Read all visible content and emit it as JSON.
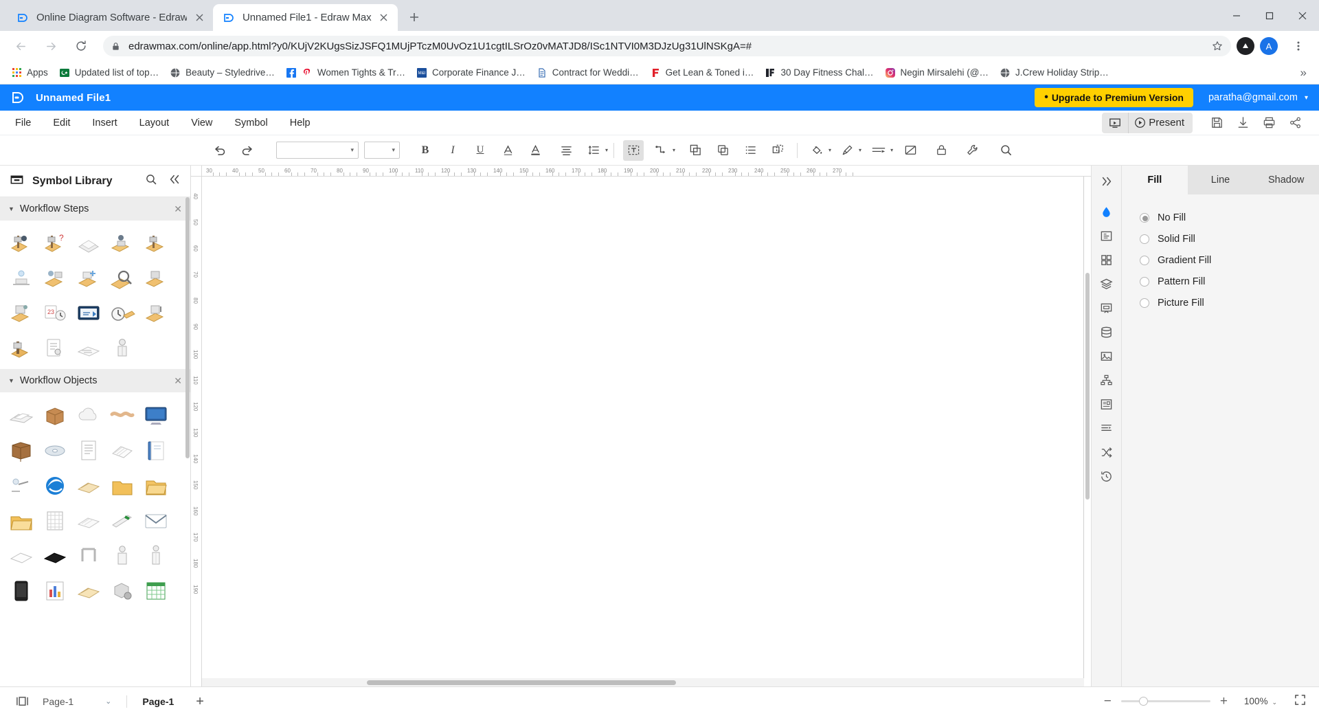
{
  "browser": {
    "tabs": [
      {
        "title": "Online Diagram Software - Edraw",
        "favicon": "edraw-icon",
        "active": false
      },
      {
        "title": "Unnamed File1 - Edraw Max",
        "favicon": "edraw-icon",
        "active": true
      }
    ],
    "new_tab_label": "+",
    "window_controls": {
      "minimize": "–",
      "maximize": "▢",
      "close": "✕"
    },
    "nav": {
      "back": "back-arrow-icon",
      "forward": "forward-arrow-icon",
      "reload": "reload-icon"
    },
    "omnibox": {
      "lock": "lock-icon",
      "url": "edrawmax.com/online/app.html?y0/KUjV2KUgsSizJSFQ1MUjPTczM0UvOz1U1cgtILSrOz0vMATJD8/ISc1NTVI0M3DJzUg31UlNSKgA=#",
      "star": "star-icon"
    },
    "profile": {
      "initial": "A"
    },
    "bookmarks": [
      {
        "label": "Apps",
        "icon": "apps-grid-icon"
      },
      {
        "label": "Updated list of top…",
        "icon": "green-flag-icon"
      },
      {
        "label": "Beauty – Styledrive…",
        "icon": "globe-dark-icon"
      },
      {
        "label": "Women Tights & Tr…",
        "icon": "facebook-icon"
      },
      {
        "label": "Corporate Finance J…",
        "icon": "mbl-blue-icon"
      },
      {
        "label": "Contract for Weddi…",
        "icon": "doc-blue-icon"
      },
      {
        "label": "Get Lean & Toned i…",
        "icon": "red-f-icon"
      },
      {
        "label": "30 Day Fitness Chal…",
        "icon": "dark-jf-icon"
      },
      {
        "label": "Negin Mirsalehi (@…",
        "icon": "instagram-icon"
      },
      {
        "label": "J.Crew Holiday Strip…",
        "icon": "globe-dark-icon"
      }
    ],
    "bookmarks_overflow": "»"
  },
  "app": {
    "title": "Unnamed File1",
    "logo": "edraw-logo-icon",
    "upgrade_label": "Upgrade to Premium Version",
    "upgrade_dot": "•",
    "account": "paratha@gmail.com",
    "account_caret": "▾",
    "menus": [
      "File",
      "Edit",
      "Insert",
      "Layout",
      "View",
      "Symbol",
      "Help"
    ],
    "present": {
      "slideshow_icon": "slideshow-icon",
      "label": "Present",
      "play_icon": "play-circle-icon"
    },
    "quick_actions": [
      {
        "name": "save-icon"
      },
      {
        "name": "download-icon"
      },
      {
        "name": "print-icon"
      },
      {
        "name": "share-icon"
      }
    ]
  },
  "formatbar": {
    "undo": "undo-icon",
    "redo": "redo-icon",
    "font_family": "",
    "font_size": "",
    "bold": "B",
    "italic": "I",
    "underline": "U",
    "font_color": "A",
    "highlight": "text-highlight-icon",
    "align": "align-icon",
    "line_spacing": "line-spacing-icon",
    "text_box": "text-box-icon",
    "connector": "connector-icon",
    "group": "group-icon",
    "duplicate": "duplicate-icon",
    "list": "list-icon",
    "arrange": "arrange-icon",
    "fill": "fill-bucket-icon",
    "line_style": "brush-icon",
    "line_type": "line-type-icon",
    "no_shape": "no-shape-icon",
    "lock": "lock-icon",
    "tools": "wrench-icon",
    "search": "search-icon"
  },
  "library": {
    "header_title": "Symbol Library",
    "header_icon": "library-box-icon",
    "search_icon": "search-icon",
    "collapse_icon": "double-chevron-left-icon",
    "sections": [
      {
        "title": "Workflow Steps",
        "close_label": "✕",
        "symbol_count": 19
      },
      {
        "title": "Workflow Objects",
        "close_label": "✕",
        "symbol_count": 30
      }
    ]
  },
  "ruler": {
    "horizontal_ticks": [
      "30",
      "40",
      "50",
      "60",
      "70",
      "80",
      "90",
      "100",
      "110",
      "120",
      "130",
      "140",
      "150",
      "160",
      "170",
      "180",
      "190",
      "200",
      "210",
      "220",
      "230",
      "240",
      "250",
      "260",
      "270"
    ],
    "vertical_ticks": [
      "40",
      "50",
      "60",
      "70",
      "80",
      "90",
      "100",
      "110",
      "120",
      "130",
      "140",
      "150",
      "160",
      "170",
      "180",
      "190"
    ]
  },
  "rail": {
    "expand_icon": "double-chevron-right-icon",
    "items": [
      {
        "name": "fill-droplet-icon",
        "active": true
      },
      {
        "name": "frame-icon",
        "active": false
      },
      {
        "name": "grid-icon",
        "active": false
      },
      {
        "name": "layers-icon",
        "active": false
      },
      {
        "name": "presentation-icon",
        "active": false
      },
      {
        "name": "database-icon",
        "active": false
      },
      {
        "name": "image-icon",
        "active": false
      },
      {
        "name": "org-chart-icon",
        "active": false
      },
      {
        "name": "theme-icon",
        "active": false
      },
      {
        "name": "note-icon",
        "active": false
      },
      {
        "name": "shuffle-icon",
        "active": false
      },
      {
        "name": "history-icon",
        "active": false
      }
    ]
  },
  "properties": {
    "tabs": [
      {
        "label": "Fill",
        "active": true
      },
      {
        "label": "Line",
        "active": false
      },
      {
        "label": "Shadow",
        "active": false
      }
    ],
    "fill_options": [
      {
        "label": "No Fill",
        "selected": true
      },
      {
        "label": "Solid Fill",
        "selected": false
      },
      {
        "label": "Gradient Fill",
        "selected": false
      },
      {
        "label": "Pattern Fill",
        "selected": false
      },
      {
        "label": "Picture Fill",
        "selected": false
      }
    ]
  },
  "statusbar": {
    "view_icon": "page-view-icon",
    "page_selector": "Page-1",
    "page_selector_caret": "⌄",
    "page_tab": "Page-1",
    "add_page": "+",
    "zoom_minus": "−",
    "zoom_plus": "+",
    "zoom_value": "100%",
    "zoom_caret": "⌄",
    "fullscreen_icon": "fullscreen-icon"
  },
  "colors": {
    "accent_blue": "#1281ff",
    "upgrade_yellow": "#ffd000",
    "chrome_bg": "#dee1e6"
  }
}
